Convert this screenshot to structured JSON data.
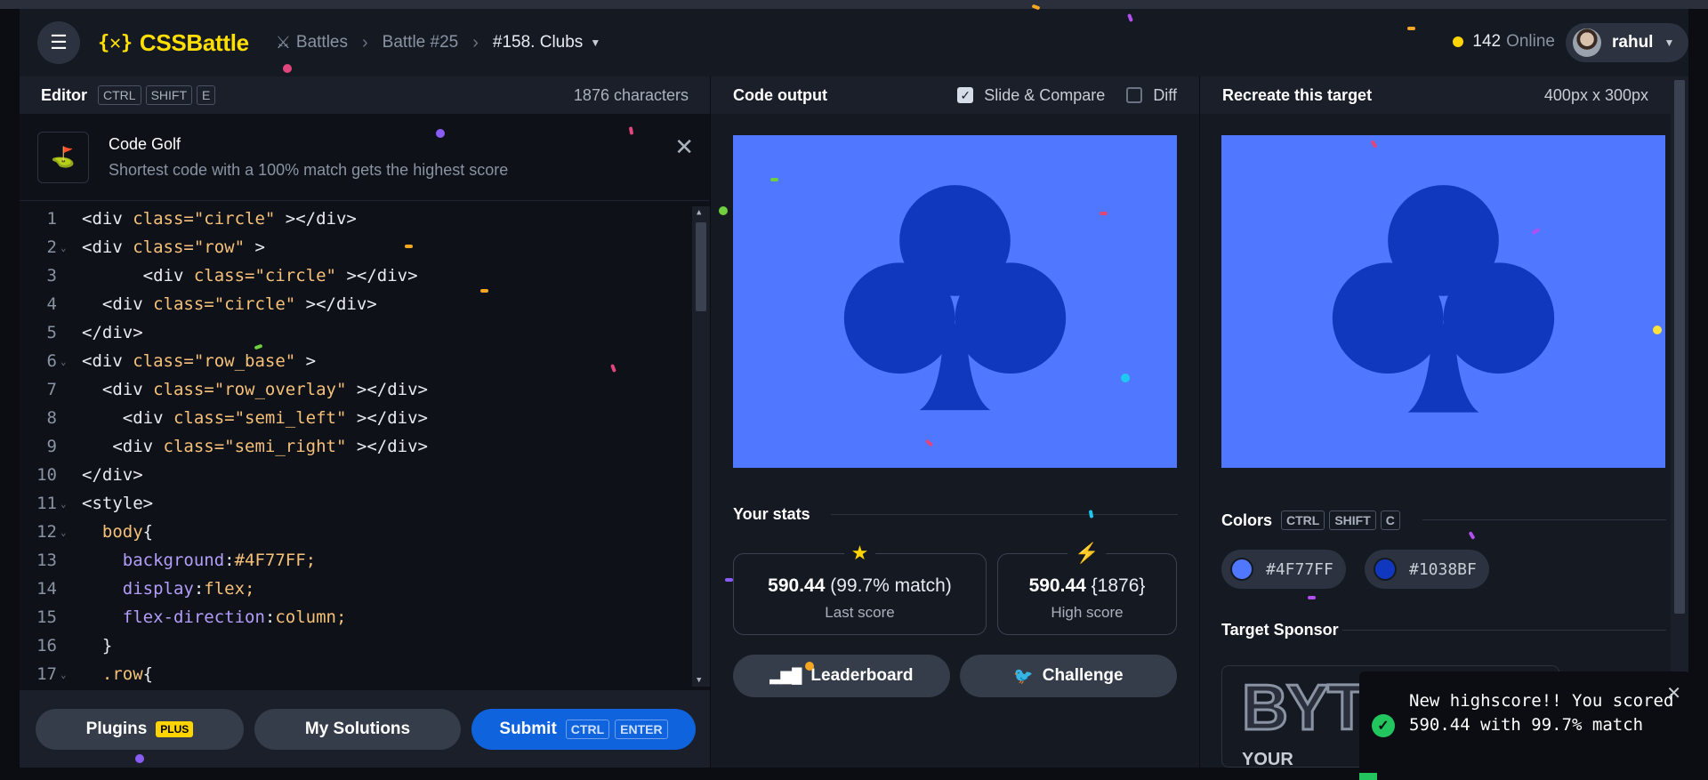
{
  "header": {
    "logo_mark": "{✕}",
    "logo_text": "CSSBattle",
    "crumbs": [
      "Battles",
      "Battle #25",
      "#158. Clubs"
    ],
    "online_count": "142",
    "online_label": "Online",
    "username": "rahul"
  },
  "editor": {
    "title": "Editor",
    "shortcut": [
      "CTRL",
      "SHIFT",
      "E"
    ],
    "char_count": "1876 characters",
    "golf_title": "Code Golf",
    "golf_subtitle": "Shortest code with a 100% match gets the highest score",
    "plugins_label": "Plugins",
    "plugins_badge": "PLUS",
    "solutions_label": "My Solutions",
    "submit_label": "Submit",
    "submit_keys": [
      "CTRL",
      "ENTER"
    ]
  },
  "output": {
    "title": "Code output",
    "slide_compare_label": "Slide & Compare",
    "slide_compare_checked": true,
    "diff_label": "Diff",
    "diff_checked": false,
    "stats_title": "Your stats",
    "last_score": "590.44",
    "last_match": "(99.7% match)",
    "last_label": "Last score",
    "high_score": "590.44",
    "high_chars": "{1876}",
    "high_label": "High score",
    "leaderboard_label": "Leaderboard",
    "challenge_label": "Challenge"
  },
  "target": {
    "title": "Recreate this target",
    "size": "400px x 300px",
    "colors_title": "Colors",
    "colors_keys": [
      "CTRL",
      "SHIFT",
      "C"
    ],
    "colors": [
      {
        "hex": "#4F77FF"
      },
      {
        "hex": "#1038BF"
      }
    ],
    "sponsor_title": "Target Sponsor",
    "sponsor_text": "BYT",
    "sponsor_sub": "YOUR"
  },
  "toast": {
    "message": "New highscore!! You scored 590.44 with 99.7% match"
  }
}
